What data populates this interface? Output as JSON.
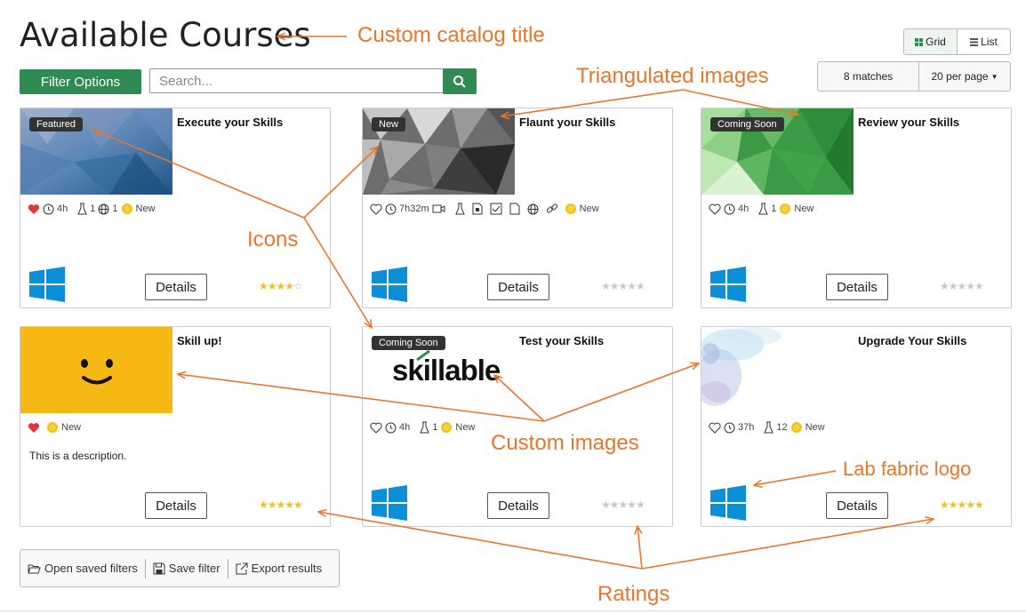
{
  "header": {
    "title": "Available Courses",
    "filter_button": "Filter Options",
    "search_placeholder": "Search...",
    "view_grid": "Grid",
    "view_list": "List",
    "matches": "8 matches",
    "per_page": "20 per page"
  },
  "cards": [
    {
      "title": "Execute your Skills",
      "badge": "Featured",
      "duration": "4h",
      "labs": "1",
      "web": "1",
      "new_label": "New",
      "details": "Details",
      "rating": 4,
      "favorite": true
    },
    {
      "title": "Flaunt your Skills",
      "badge": "New",
      "duration": "7h32m",
      "new_label": "New",
      "details": "Details",
      "rating": 0,
      "favorite": false
    },
    {
      "title": "Review your Skills",
      "badge": "Coming Soon",
      "duration": "4h",
      "labs": "1",
      "new_label": "New",
      "details": "Details",
      "rating": 0,
      "favorite": false
    },
    {
      "title": "Skill up!",
      "new_label": "New",
      "description": "This is a description.",
      "details": "Details",
      "rating": 5,
      "favorite": true
    },
    {
      "title": "Test your Skills",
      "badge": "Coming Soon",
      "logo_text": "skillable",
      "duration": "4h",
      "labs": "1",
      "new_label": "New",
      "details": "Details",
      "rating": 0,
      "favorite": false
    },
    {
      "title": "Upgrade Your Skills",
      "duration": "37h",
      "labs": "12",
      "new_label": "New",
      "details": "Details",
      "rating": 5,
      "favorite": false
    }
  ],
  "footer": {
    "open_saved": "Open saved filters",
    "save_filter": "Save filter",
    "export": "Export results"
  },
  "annotations": {
    "catalog_title": "Custom catalog title",
    "triangulated": "Triangulated images",
    "icons": "Icons",
    "custom_images": "Custom images",
    "lab_fabric": "Lab fabric logo",
    "ratings": "Ratings"
  },
  "colors": {
    "primary": "#2f8a53",
    "annotation": "#e8762c",
    "heart": "#e0363b",
    "star": "#f2c21b",
    "star_empty": "#c8c8c8"
  }
}
